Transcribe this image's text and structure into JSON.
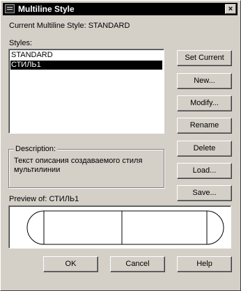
{
  "window": {
    "title": "Multiline Style",
    "close_glyph": "×"
  },
  "current_style": {
    "label": "Current Multiline Style:",
    "value": "STANDARD"
  },
  "styles": {
    "label": "Styles:",
    "items": [
      {
        "label": "STANDARD",
        "selected": false
      },
      {
        "label": "СТИЛЬ1",
        "selected": true
      }
    ]
  },
  "buttons": {
    "set_current": "Set Current",
    "new": "New...",
    "modify": "Modify...",
    "rename": "Rename",
    "delete": "Delete",
    "load": "Load...",
    "save": "Save...",
    "ok": "OK",
    "cancel": "Cancel",
    "help": "Help"
  },
  "description": {
    "label": "Description:",
    "line1": "Текст описания создаваемого стиля",
    "line2": "мультилинии"
  },
  "preview": {
    "label": "Preview of:",
    "style_name": "СТИЛЬ1"
  },
  "colors": {
    "face": "#d4d0c8",
    "selection": "#000000",
    "title_bar": "#000000"
  }
}
